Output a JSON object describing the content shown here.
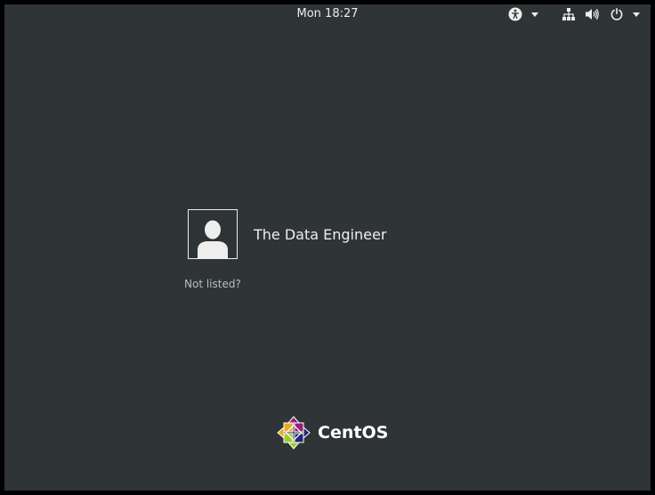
{
  "topbar": {
    "day": "Mon",
    "time": "18:27",
    "accessibility_icon": "accessibility-icon",
    "network_icon": "network-wired-icon",
    "volume_icon": "volume-icon",
    "power_icon": "power-icon"
  },
  "users": [
    {
      "name": "The Data Engineer",
      "avatar_icon": "user-silhouette-icon"
    }
  ],
  "not_listed_label": "Not listed?",
  "logo": {
    "text": "CentOS",
    "icon": "centos-logo-icon",
    "colors": [
      "#efa724",
      "#9ccd2a",
      "#932279",
      "#262577"
    ]
  },
  "colors": {
    "background": "#2e3436",
    "foreground": "#eeeeec",
    "muted": "#babdb6"
  }
}
